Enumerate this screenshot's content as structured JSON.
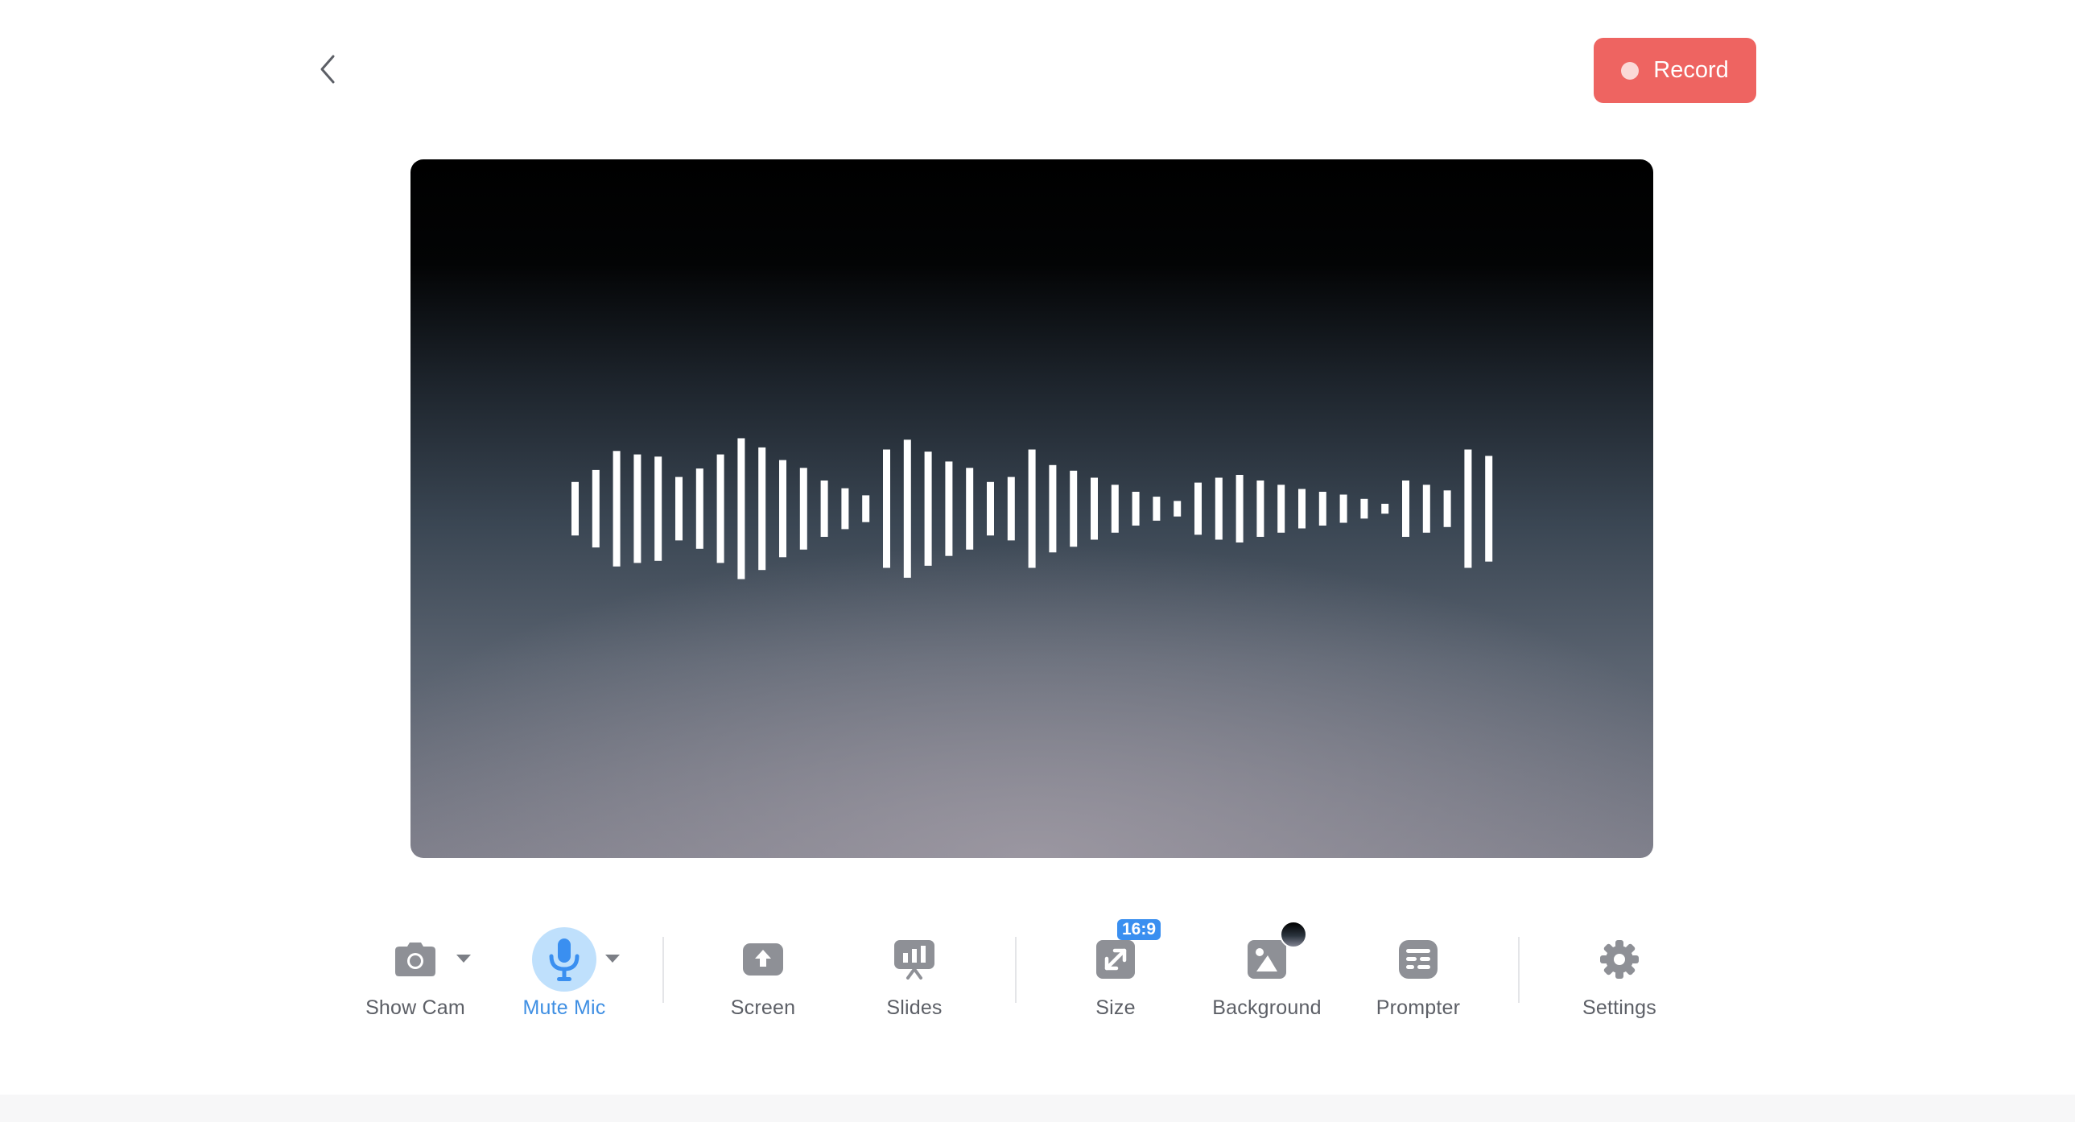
{
  "header": {
    "back_icon": "chevron-left-icon",
    "record_label": "Record"
  },
  "preview": {
    "visualizer": "audio-waveform",
    "waveform_levels": [
      0.38,
      0.55,
      0.82,
      0.77,
      0.74,
      0.45,
      0.57,
      0.77,
      1.0,
      0.87,
      0.69,
      0.58,
      0.4,
      0.29,
      0.19,
      0.84,
      0.98,
      0.81,
      0.67,
      0.58,
      0.38,
      0.45,
      0.84,
      0.62,
      0.54,
      0.44,
      0.34,
      0.24,
      0.17,
      0.11,
      0.37,
      0.44,
      0.48,
      0.4,
      0.34,
      0.28,
      0.24,
      0.2,
      0.14,
      0.07,
      0.4,
      0.34,
      0.26,
      0.84,
      0.75
    ],
    "colors": {
      "top": "#000000",
      "bottom": "#7b7c88",
      "bars": "#ffffff"
    }
  },
  "toolbar": {
    "camera": {
      "label": "Show Cam",
      "icon": "camera-icon"
    },
    "mic": {
      "label": "Mute Mic",
      "icon": "microphone-icon",
      "active": true
    },
    "screen": {
      "label": "Screen",
      "icon": "screen-share-icon"
    },
    "slides": {
      "label": "Slides",
      "icon": "slides-icon"
    },
    "size": {
      "label": "Size",
      "icon": "resize-icon",
      "badge": "16:9"
    },
    "background": {
      "label": "Background",
      "icon": "image-icon"
    },
    "prompter": {
      "label": "Prompter",
      "icon": "prompter-icon"
    },
    "settings": {
      "label": "Settings",
      "icon": "gear-icon"
    }
  },
  "colors": {
    "record": "#ee6461",
    "accent": "#3f8fe3",
    "icon_gray": "#8e9096",
    "label_gray": "#5c5f66"
  }
}
